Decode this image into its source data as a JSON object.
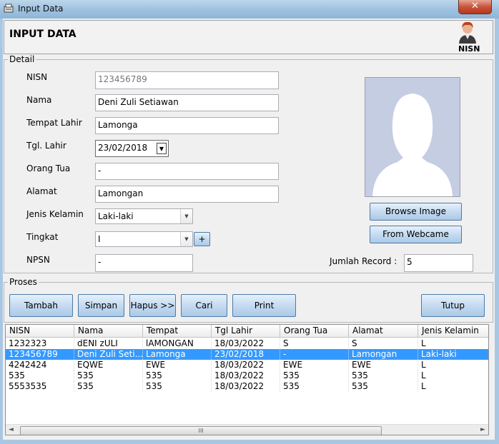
{
  "window": {
    "title": "Input Data",
    "close_label": "✕"
  },
  "header": {
    "title": "INPUT DATA",
    "badge_label": "NISN"
  },
  "detail": {
    "legend": "Detail",
    "fields": {
      "nisn": {
        "label": "NISN",
        "value": "123456789"
      },
      "nama": {
        "label": "Nama",
        "value": "Deni Zuli Setiawan"
      },
      "tempat_lahir": {
        "label": "Tempat Lahir",
        "value": "Lamonga"
      },
      "tgl_lahir": {
        "label": "Tgl. Lahir",
        "value": "23/02/2018"
      },
      "orang_tua": {
        "label": "Orang Tua",
        "value": "-"
      },
      "alamat": {
        "label": "Alamat",
        "value": "Lamongan"
      },
      "jenis_kelamin": {
        "label": "Jenis Kelamin",
        "value": "Laki-laki"
      },
      "tingkat": {
        "label": "Tingkat",
        "value": "I",
        "add_label": "+"
      },
      "npsn": {
        "label": "NPSN",
        "value": "-"
      }
    },
    "browse_image_label": "Browse Image",
    "webcam_label": "From Webcame",
    "jumlah_record_label": "Jumlah Record :",
    "jumlah_record_value": "5"
  },
  "proses": {
    "legend": "Proses",
    "buttons": {
      "tambah": "Tambah",
      "simpan": "Simpan",
      "hapus": "Hapus >>",
      "cari": "Cari",
      "print": "Print",
      "tutup": "Tutup"
    }
  },
  "table": {
    "columns": [
      "NISN",
      "Nama",
      "Tempat",
      "Tgl  Lahir",
      "Orang Tua",
      "Alamat",
      "Jenis Kelamin"
    ],
    "rows": [
      [
        "1232323",
        "dENI zULI",
        "lAMONGAN",
        "18/03/2022",
        "S",
        "S",
        "L"
      ],
      [
        "123456789",
        "Deni Zuli Seti...",
        "Lamonga",
        "23/02/2018",
        "-",
        "Lamongan",
        "Laki-laki"
      ],
      [
        "4242424",
        "EQWE",
        "EWE",
        "18/03/2022",
        "EWE",
        "EWE",
        "L"
      ],
      [
        "535",
        "535",
        "535",
        "18/03/2022",
        "535",
        "535",
        "L"
      ],
      [
        "5553535",
        "535",
        "535",
        "18/03/2022",
        "535",
        "535",
        "L"
      ]
    ],
    "selected_row": 1,
    "scroll_thumb_label": "III"
  },
  "colors": {
    "accent": "#3399ff",
    "button_border": "#4c7aa6",
    "close": "#c7553b"
  }
}
